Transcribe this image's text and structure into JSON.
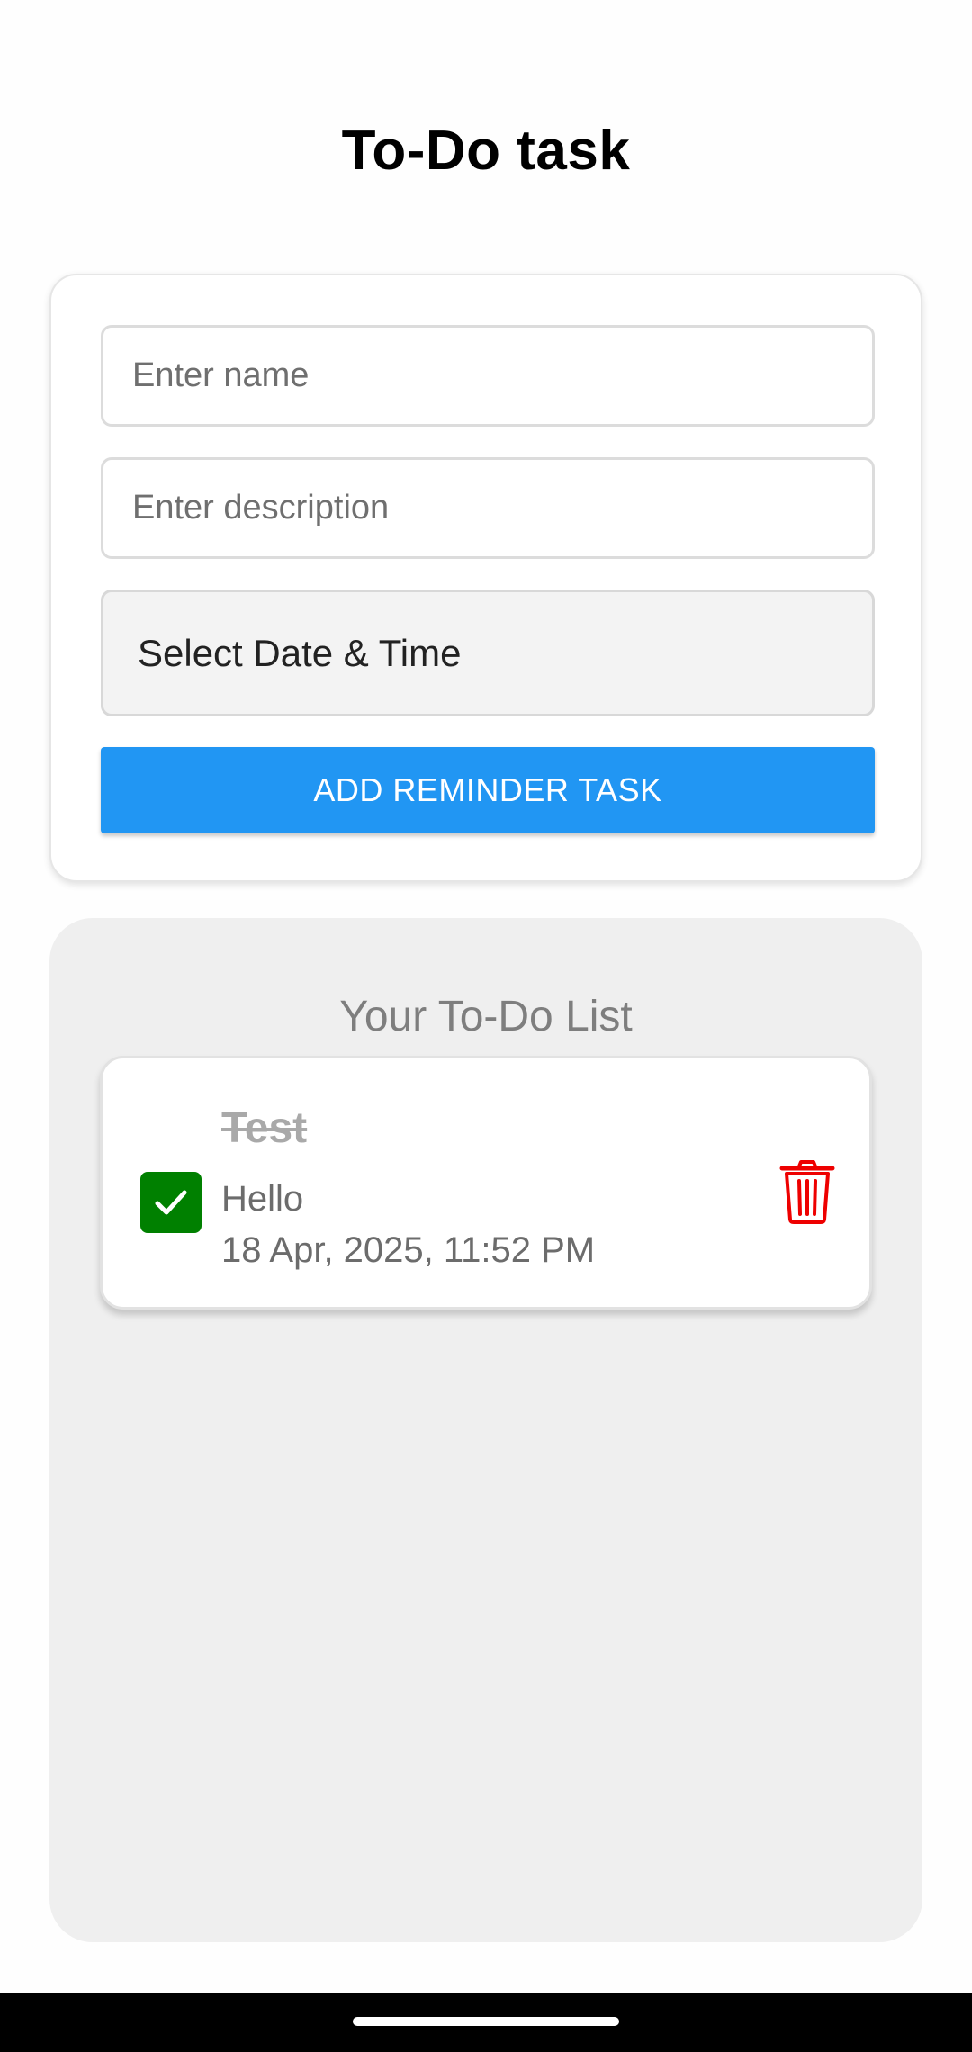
{
  "header": {
    "title": "To-Do task"
  },
  "form": {
    "name_placeholder": "Enter name",
    "name_value": "",
    "description_placeholder": "Enter description",
    "description_value": "",
    "datetime_label": "Select Date & Time",
    "add_button_label": "ADD REMINDER TASK"
  },
  "list": {
    "heading": "Your To-Do List",
    "items": [
      {
        "name": "Test",
        "description": "Hello",
        "datetime": "18 Apr, 2025, 11:52 PM",
        "completed": true,
        "checkbox_icon": "checkmark-icon",
        "delete_icon": "trash-icon"
      }
    ]
  },
  "colors": {
    "accent_button": "#2196f3",
    "checkbox_checked": "#008000",
    "delete_icon": "#ee0000",
    "completed_text": "#a9a9a9"
  }
}
